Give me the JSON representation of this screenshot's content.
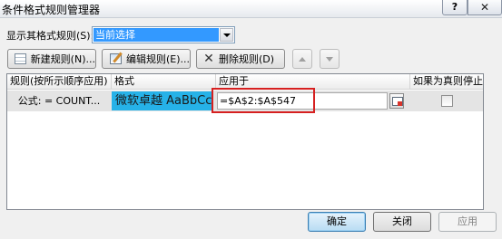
{
  "window": {
    "title": "条件格式规则管理器",
    "help": "?",
    "close": "✕"
  },
  "show_rules": {
    "label": "显示其格式规则(S):",
    "selected": "当前选择"
  },
  "toolbar": {
    "new_rule": "新建规则(N)...",
    "edit_rule": "编辑规则(E)...",
    "delete_rule": "删除规则(D)"
  },
  "rules_table": {
    "columns": [
      "规则(按所示顺序应用)",
      "格式",
      "应用于",
      "如果为真则停止"
    ],
    "rows": [
      {
        "rule": "公式: = COUNT...",
        "format_preview": "微软卓越  AaBbCc",
        "applies_to": "=$A$2:$A$547",
        "stop_if_true": false
      }
    ]
  },
  "footer": {
    "ok": "确定",
    "close": "关闭",
    "apply": "应用"
  },
  "colors": {
    "selection": "#3399ff",
    "format_preview_bg": "#26b2e8",
    "highlight_border": "#d62020"
  },
  "icons": [
    "new-rule-icon",
    "edit-rule-icon",
    "delete-icon",
    "move-up-icon",
    "move-down-icon",
    "collapse-dialog-icon"
  ]
}
